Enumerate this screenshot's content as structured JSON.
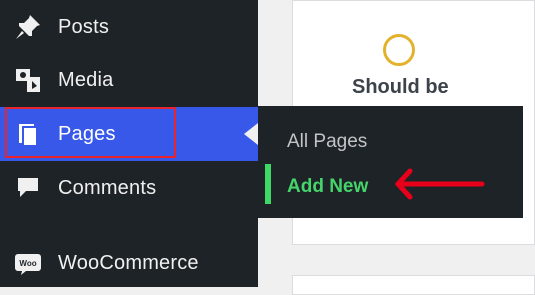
{
  "sidebar": {
    "items": [
      {
        "label": "Posts",
        "icon": "pin-icon"
      },
      {
        "label": "Media",
        "icon": "media-icon"
      },
      {
        "label": "Pages",
        "icon": "pages-icon"
      },
      {
        "label": "Comments",
        "icon": "comment-icon"
      },
      {
        "label": "WooCommerce",
        "icon": "woocommerce-icon"
      }
    ],
    "woo_logo_text": "Woo"
  },
  "submenu": {
    "items": [
      {
        "label": "All Pages"
      },
      {
        "label": "Add New"
      }
    ]
  },
  "content": {
    "text": "Should be"
  },
  "colors": {
    "sidebar_bg": "#1d2327",
    "active_bg": "#3858e9",
    "highlight": "#e8252c",
    "submenu_active": "#46d46a"
  }
}
